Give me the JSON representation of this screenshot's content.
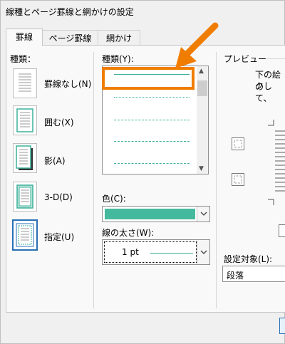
{
  "dialog": {
    "title": "線種とページ罫線と網かけの設定"
  },
  "tabs": [
    {
      "label": "罫線"
    },
    {
      "label": "ページ罫線"
    },
    {
      "label": "網かけ"
    }
  ],
  "settings": {
    "label": "種類：",
    "items": [
      {
        "label": "罫線なし(N)"
      },
      {
        "label": "囲む(X)"
      },
      {
        "label": "影(A)"
      },
      {
        "label": "3-D(D)"
      },
      {
        "label": "指定(U)"
      }
    ]
  },
  "style": {
    "label": "種類(Y):",
    "options": [
      "solid",
      "dotted",
      "dash-dot-dot",
      "dashed",
      "dash-dot"
    ],
    "selected_index": 0
  },
  "color": {
    "label": "色(C):",
    "value": "#45b99d"
  },
  "width": {
    "label": "線の太さ(W):",
    "value": "1 pt"
  },
  "preview": {
    "label": "プレビュー",
    "desc_line1": "下の絵の",
    "desc_line2": "クして、"
  },
  "apply_to": {
    "label": "設定対象(L):",
    "value": "段落"
  },
  "colors": {
    "accent": "#3cb09a",
    "annotation": "#f07d00",
    "selection": "#2a6fb5"
  }
}
